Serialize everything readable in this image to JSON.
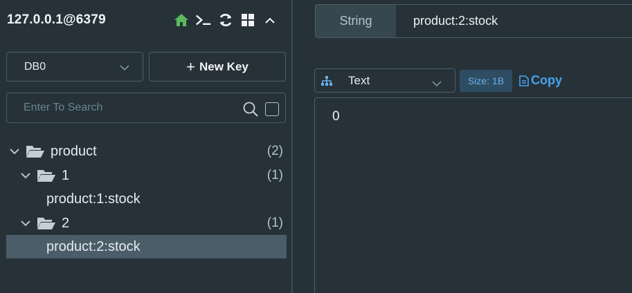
{
  "connection": {
    "title": "127.0.0.1@6379"
  },
  "toolbar": {
    "icons": [
      "home-icon",
      "terminal-icon",
      "refresh-icon",
      "grid-icon",
      "chevron-up-icon"
    ],
    "colors": {
      "home": "#5cb85c"
    }
  },
  "db_select": {
    "value": "DB0"
  },
  "new_key": {
    "label": "New Key"
  },
  "search": {
    "placeholder": "Enter To Search"
  },
  "tree": [
    {
      "label": "product",
      "count": "(2)",
      "level": 0,
      "type": "folder",
      "expanded": true
    },
    {
      "label": "1",
      "count": "(1)",
      "level": 1,
      "type": "folder",
      "expanded": true
    },
    {
      "label": "product:1:stock",
      "count": "",
      "level": 2,
      "type": "key"
    },
    {
      "label": "2",
      "count": "(1)",
      "level": 1,
      "type": "folder",
      "expanded": true
    },
    {
      "label": "product:2:stock",
      "count": "",
      "level": 2,
      "type": "key",
      "selected": true
    }
  ],
  "key_detail": {
    "type": "String",
    "name": "product:2:stock",
    "format": "Text",
    "size": "Size: 1B",
    "copy_label": "Copy",
    "value": "0"
  },
  "colors": {
    "background": "#263238",
    "selected_row": "#4a5d68",
    "accent_blue": "#4aa3f0",
    "border": "#4d5e69"
  }
}
